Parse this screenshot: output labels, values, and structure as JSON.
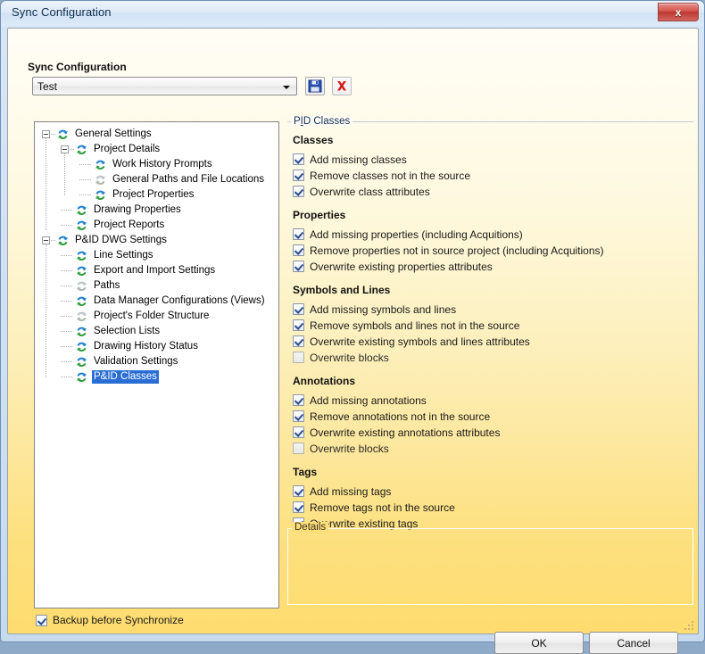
{
  "window": {
    "title": "Sync Configuration",
    "close_label": "x",
    "close_icon": "close-icon"
  },
  "toolbar": {
    "section_label": "Sync Configuration",
    "combo_value": "Test",
    "combo_arrow_icon": "chevron-down-icon",
    "save_icon": "save-floppy-icon",
    "delete_icon": "delete-x-icon"
  },
  "tree": {
    "nodes": [
      {
        "label": "General Settings",
        "depth": 0,
        "expanded": true,
        "dim": false,
        "selected": false
      },
      {
        "label": "Project Details",
        "depth": 1,
        "expanded": true,
        "dim": false,
        "selected": false
      },
      {
        "label": "Work History Prompts",
        "depth": 2,
        "expanded": null,
        "dim": false,
        "selected": false
      },
      {
        "label": "General Paths and File Locations",
        "depth": 2,
        "expanded": null,
        "dim": true,
        "selected": false
      },
      {
        "label": "Project Properties",
        "depth": 2,
        "expanded": null,
        "dim": false,
        "selected": false
      },
      {
        "label": "Drawing Properties",
        "depth": 1,
        "expanded": null,
        "dim": false,
        "selected": false
      },
      {
        "label": "Project Reports",
        "depth": 1,
        "expanded": null,
        "dim": false,
        "selected": false
      },
      {
        "label": "P&ID DWG Settings",
        "depth": 0,
        "expanded": true,
        "dim": false,
        "selected": false
      },
      {
        "label": "Line Settings",
        "depth": 1,
        "expanded": null,
        "dim": false,
        "selected": false
      },
      {
        "label": "Export and Import Settings",
        "depth": 1,
        "expanded": null,
        "dim": false,
        "selected": false
      },
      {
        "label": "Paths",
        "depth": 1,
        "expanded": null,
        "dim": true,
        "selected": false
      },
      {
        "label": "Data Manager Configurations (Views)",
        "depth": 1,
        "expanded": null,
        "dim": false,
        "selected": false
      },
      {
        "label": "Project's Folder Structure",
        "depth": 1,
        "expanded": null,
        "dim": true,
        "selected": false
      },
      {
        "label": "Selection Lists",
        "depth": 1,
        "expanded": null,
        "dim": false,
        "selected": false
      },
      {
        "label": "Drawing History Status",
        "depth": 1,
        "expanded": null,
        "dim": false,
        "selected": false
      },
      {
        "label": "Validation Settings",
        "depth": 1,
        "expanded": null,
        "dim": false,
        "selected": false
      },
      {
        "label": "P&ID Classes",
        "depth": 1,
        "expanded": null,
        "dim": false,
        "selected": true
      }
    ]
  },
  "pid_group": {
    "caption_before": "P",
    "caption_accel": "I",
    "caption_after": "D Classes",
    "sections": [
      {
        "heading": "Classes",
        "options": [
          {
            "label": "Add missing classes",
            "checked": true,
            "disabled": false
          },
          {
            "label": "Remove classes not in the source",
            "checked": true,
            "disabled": false
          },
          {
            "label": "Overwrite class attributes",
            "checked": true,
            "disabled": false
          }
        ]
      },
      {
        "heading": "Properties",
        "options": [
          {
            "label": "Add missing properties (including Acquitions)",
            "checked": true,
            "disabled": false
          },
          {
            "label": "Remove properties not in source project (including Acquitions)",
            "checked": true,
            "disabled": false
          },
          {
            "label": "Overwrite existing properties attributes",
            "checked": true,
            "disabled": false
          }
        ]
      },
      {
        "heading": "Symbols and Lines",
        "options": [
          {
            "label": "Add missing symbols and lines",
            "checked": true,
            "disabled": false
          },
          {
            "label": "Remove symbols and lines not in the source",
            "checked": true,
            "disabled": false
          },
          {
            "label": "Overwrite existing symbols and lines attributes",
            "checked": true,
            "disabled": false
          },
          {
            "label": "Overwrite blocks",
            "checked": false,
            "disabled": true
          }
        ]
      },
      {
        "heading": "Annotations",
        "options": [
          {
            "label": "Add missing annotations",
            "checked": true,
            "disabled": false
          },
          {
            "label": "Remove annotations not in the source",
            "checked": true,
            "disabled": false
          },
          {
            "label": "Overwrite existing annotations attributes",
            "checked": true,
            "disabled": false
          },
          {
            "label": "Overwrite blocks",
            "checked": false,
            "disabled": true
          }
        ]
      },
      {
        "heading": "Tags",
        "options": [
          {
            "label": "Add missing tags",
            "checked": true,
            "disabled": false
          },
          {
            "label": "Remove tags not in the source",
            "checked": true,
            "disabled": false
          },
          {
            "label": "Overwrite existing tags",
            "checked": true,
            "disabled": false
          }
        ]
      }
    ]
  },
  "details_group": {
    "caption": "Details",
    "content": ""
  },
  "footer": {
    "backup_label": "Backup before Synchronize",
    "backup_checked": true,
    "ok_label": "OK",
    "cancel_label": "Cancel"
  },
  "colors": {
    "selection_blue": "#2a6ed4",
    "dialog_yellow": "#fdde7a",
    "titlebar_blue": "#d2e2f4",
    "close_red": "#bd3a33",
    "icon_blue": "#1f7fd0",
    "icon_green": "#2e9b3e"
  }
}
